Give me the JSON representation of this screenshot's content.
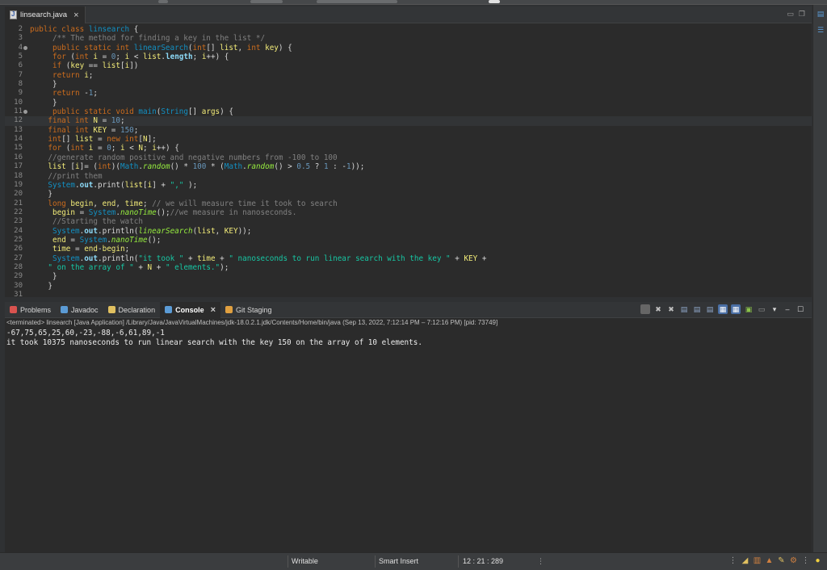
{
  "editor": {
    "tab_label": "linsearch.java",
    "lines": [
      {
        "n": "2",
        "fold": false,
        "current": false,
        "segs": [
          [
            "kw",
            "public class "
          ],
          [
            "cl",
            "linsearch"
          ],
          [
            "ty",
            " {"
          ]
        ]
      },
      {
        "n": "3",
        "fold": false,
        "current": false,
        "segs": [
          [
            "cm",
            "     /** The method for finding a key in the list */"
          ]
        ]
      },
      {
        "n": "4",
        "fold": true,
        "current": false,
        "segs": [
          [
            "ty",
            "     "
          ],
          [
            "kw",
            "public static int "
          ],
          [
            "cl",
            "linearSearch"
          ],
          [
            "ty",
            "("
          ],
          [
            "kw",
            "int"
          ],
          [
            "ty",
            "[] "
          ],
          [
            "lv",
            "list"
          ],
          [
            "ty",
            ", "
          ],
          [
            "kw",
            "int "
          ],
          [
            "lv",
            "key"
          ],
          [
            "ty",
            ") {"
          ]
        ]
      },
      {
        "n": "5",
        "fold": false,
        "current": false,
        "segs": [
          [
            "ty",
            "     "
          ],
          [
            "kw",
            "for "
          ],
          [
            "ty",
            "("
          ],
          [
            "kw",
            "int "
          ],
          [
            "lv",
            "i"
          ],
          [
            "ty",
            " = "
          ],
          [
            "nu",
            "0"
          ],
          [
            "ty",
            "; "
          ],
          [
            "lv",
            "i"
          ],
          [
            "ty",
            " < "
          ],
          [
            "lv",
            "list"
          ],
          [
            "ty",
            "."
          ],
          [
            "fi",
            "length"
          ],
          [
            "ty",
            "; "
          ],
          [
            "lv",
            "i"
          ],
          [
            "ty",
            "++) {"
          ]
        ]
      },
      {
        "n": "6",
        "fold": false,
        "current": false,
        "segs": [
          [
            "ty",
            "     "
          ],
          [
            "kw",
            "if "
          ],
          [
            "ty",
            "("
          ],
          [
            "lv",
            "key"
          ],
          [
            "ty",
            " == "
          ],
          [
            "lv",
            "list"
          ],
          [
            "ty",
            "["
          ],
          [
            "lv",
            "i"
          ],
          [
            "ty",
            "])"
          ]
        ]
      },
      {
        "n": "7",
        "fold": false,
        "current": false,
        "segs": [
          [
            "ty",
            "     "
          ],
          [
            "kw",
            "return "
          ],
          [
            "lv",
            "i"
          ],
          [
            "ty",
            ";"
          ]
        ]
      },
      {
        "n": "8",
        "fold": false,
        "current": false,
        "segs": [
          [
            "ty",
            "     }"
          ]
        ]
      },
      {
        "n": "9",
        "fold": false,
        "current": false,
        "segs": [
          [
            "ty",
            "     "
          ],
          [
            "kw",
            "return "
          ],
          [
            "ty",
            "-"
          ],
          [
            "nu",
            "1"
          ],
          [
            "ty",
            ";"
          ]
        ]
      },
      {
        "n": "10",
        "fold": false,
        "current": false,
        "segs": [
          [
            "ty",
            "     }"
          ]
        ]
      },
      {
        "n": "11",
        "fold": true,
        "current": false,
        "segs": [
          [
            "ty",
            "     "
          ],
          [
            "kw",
            "public static void "
          ],
          [
            "cl",
            "main"
          ],
          [
            "ty",
            "("
          ],
          [
            "cl",
            "String"
          ],
          [
            "ty",
            "[] "
          ],
          [
            "lv",
            "args"
          ],
          [
            "ty",
            ") {"
          ]
        ]
      },
      {
        "n": "12",
        "fold": false,
        "current": true,
        "segs": [
          [
            "ty",
            "    "
          ],
          [
            "kw",
            "final int "
          ],
          [
            "lv",
            "N"
          ],
          [
            "ty",
            " = "
          ],
          [
            "nu",
            "10"
          ],
          [
            "ty",
            ";"
          ]
        ]
      },
      {
        "n": "13",
        "fold": false,
        "current": false,
        "segs": [
          [
            "ty",
            "    "
          ],
          [
            "kw",
            "final int "
          ],
          [
            "lv",
            "KEY"
          ],
          [
            "ty",
            " = "
          ],
          [
            "nu",
            "150"
          ],
          [
            "ty",
            ";"
          ]
        ]
      },
      {
        "n": "14",
        "fold": false,
        "current": false,
        "segs": [
          [
            "ty",
            "    "
          ],
          [
            "kw",
            "int"
          ],
          [
            "ty",
            "[] "
          ],
          [
            "lv",
            "list"
          ],
          [
            "ty",
            " = "
          ],
          [
            "kw",
            "new int"
          ],
          [
            "ty",
            "["
          ],
          [
            "lv",
            "N"
          ],
          [
            "ty",
            "];"
          ]
        ]
      },
      {
        "n": "15",
        "fold": false,
        "current": false,
        "segs": [
          [
            "ty",
            "    "
          ],
          [
            "kw",
            "for "
          ],
          [
            "ty",
            "("
          ],
          [
            "kw",
            "int "
          ],
          [
            "lv",
            "i"
          ],
          [
            "ty",
            " = "
          ],
          [
            "nu",
            "0"
          ],
          [
            "ty",
            "; "
          ],
          [
            "lv",
            "i"
          ],
          [
            "ty",
            " < "
          ],
          [
            "lv",
            "N"
          ],
          [
            "ty",
            "; "
          ],
          [
            "lv",
            "i"
          ],
          [
            "ty",
            "++) {"
          ]
        ]
      },
      {
        "n": "16",
        "fold": false,
        "current": false,
        "segs": [
          [
            "cm",
            "    //generate random positive and negative numbers from -100 to 100"
          ]
        ]
      },
      {
        "n": "17",
        "fold": false,
        "current": false,
        "segs": [
          [
            "ty",
            "    "
          ],
          [
            "lv",
            "list"
          ],
          [
            "ty",
            " ["
          ],
          [
            "lv",
            "i"
          ],
          [
            "ty",
            "]= ("
          ],
          [
            "kw",
            "int"
          ],
          [
            "ty",
            ")("
          ],
          [
            "cl",
            "Math"
          ],
          [
            "ty",
            "."
          ],
          [
            "it",
            "random"
          ],
          [
            "ty",
            "() * "
          ],
          [
            "nu",
            "100"
          ],
          [
            "ty",
            " * ("
          ],
          [
            "cl",
            "Math"
          ],
          [
            "ty",
            "."
          ],
          [
            "it",
            "random"
          ],
          [
            "ty",
            "() > "
          ],
          [
            "nu",
            "0.5"
          ],
          [
            "ty",
            " ? "
          ],
          [
            "nu",
            "1"
          ],
          [
            "ty",
            " : -"
          ],
          [
            "nu",
            "1"
          ],
          [
            "ty",
            "));"
          ]
        ]
      },
      {
        "n": "18",
        "fold": false,
        "current": false,
        "segs": [
          [
            "cm",
            "    //print them"
          ]
        ]
      },
      {
        "n": "19",
        "fold": false,
        "current": false,
        "segs": [
          [
            "ty",
            "    "
          ],
          [
            "cl",
            "System"
          ],
          [
            "ty",
            "."
          ],
          [
            "fi",
            "out"
          ],
          [
            "ty",
            "."
          ],
          [
            "ty",
            "print("
          ],
          [
            "lv",
            "list"
          ],
          [
            "ty",
            "["
          ],
          [
            "lv",
            "i"
          ],
          [
            "ty",
            "] + "
          ],
          [
            "st",
            "\",\""
          ],
          [
            "ty",
            " );"
          ]
        ]
      },
      {
        "n": "20",
        "fold": false,
        "current": false,
        "segs": [
          [
            "ty",
            "    }"
          ]
        ]
      },
      {
        "n": "21",
        "fold": false,
        "current": false,
        "segs": [
          [
            "ty",
            "    "
          ],
          [
            "kw",
            "long "
          ],
          [
            "lv",
            "begin"
          ],
          [
            "ty",
            ", "
          ],
          [
            "lv",
            "end"
          ],
          [
            "ty",
            ", "
          ],
          [
            "lv",
            "time"
          ],
          [
            "ty",
            "; "
          ],
          [
            "cm",
            "// we will measure time it took to search"
          ]
        ]
      },
      {
        "n": "22",
        "fold": false,
        "current": false,
        "segs": [
          [
            "ty",
            "     "
          ],
          [
            "lv",
            "begin"
          ],
          [
            "ty",
            " = "
          ],
          [
            "cl",
            "System"
          ],
          [
            "ty",
            "."
          ],
          [
            "it",
            "nanoTime"
          ],
          [
            "ty",
            "();"
          ],
          [
            "cm",
            "//we measure in nanoseconds."
          ]
        ]
      },
      {
        "n": "23",
        "fold": false,
        "current": false,
        "segs": [
          [
            "cm",
            "     //Starting the watch"
          ]
        ]
      },
      {
        "n": "24",
        "fold": false,
        "current": false,
        "segs": [
          [
            "ty",
            "     "
          ],
          [
            "cl",
            "System"
          ],
          [
            "ty",
            "."
          ],
          [
            "fi",
            "out"
          ],
          [
            "ty",
            "."
          ],
          [
            "ty",
            "println("
          ],
          [
            "it",
            "linearSearch"
          ],
          [
            "ty",
            "("
          ],
          [
            "lv",
            "list"
          ],
          [
            "ty",
            ", "
          ],
          [
            "lv",
            "KEY"
          ],
          [
            "ty",
            "));"
          ]
        ]
      },
      {
        "n": "25",
        "fold": false,
        "current": false,
        "segs": [
          [
            "ty",
            "     "
          ],
          [
            "lv",
            "end"
          ],
          [
            "ty",
            " = "
          ],
          [
            "cl",
            "System"
          ],
          [
            "ty",
            "."
          ],
          [
            "it",
            "nanoTime"
          ],
          [
            "ty",
            "();"
          ]
        ]
      },
      {
        "n": "26",
        "fold": false,
        "current": false,
        "segs": [
          [
            "ty",
            "     "
          ],
          [
            "lv",
            "time"
          ],
          [
            "ty",
            " = "
          ],
          [
            "lv",
            "end"
          ],
          [
            "ty",
            "-"
          ],
          [
            "lv",
            "begin"
          ],
          [
            "ty",
            ";"
          ]
        ]
      },
      {
        "n": "27",
        "fold": false,
        "current": false,
        "segs": [
          [
            "ty",
            "     "
          ],
          [
            "cl",
            "System"
          ],
          [
            "ty",
            "."
          ],
          [
            "fi",
            "out"
          ],
          [
            "ty",
            "."
          ],
          [
            "ty",
            "println("
          ],
          [
            "st",
            "\"it took \""
          ],
          [
            "ty",
            " + "
          ],
          [
            "lv",
            "time"
          ],
          [
            "ty",
            " + "
          ],
          [
            "st",
            "\" nanoseconds to run linear search with the key \""
          ],
          [
            "ty",
            " + "
          ],
          [
            "lv",
            "KEY"
          ],
          [
            "ty",
            " +"
          ]
        ]
      },
      {
        "n": "28",
        "fold": false,
        "current": false,
        "segs": [
          [
            "ty",
            "    "
          ],
          [
            "st",
            "\" on the array of \""
          ],
          [
            "ty",
            " + "
          ],
          [
            "lv",
            "N"
          ],
          [
            "ty",
            " + "
          ],
          [
            "st",
            "\" elements.\""
          ],
          [
            "ty",
            ");"
          ]
        ]
      },
      {
        "n": "29",
        "fold": false,
        "current": false,
        "segs": [
          [
            "ty",
            "     }"
          ]
        ]
      },
      {
        "n": "30",
        "fold": false,
        "current": false,
        "segs": [
          [
            "ty",
            "    }"
          ]
        ]
      },
      {
        "n": "31",
        "fold": false,
        "current": false,
        "segs": [
          [
            "ty",
            ""
          ]
        ]
      }
    ]
  },
  "panel": {
    "tabs": [
      {
        "label": "Problems",
        "icon": "problems-icon",
        "color": "#d9534f",
        "active": false
      },
      {
        "label": "Javadoc",
        "icon": "javadoc-icon",
        "color": "#5b9bd5",
        "active": false
      },
      {
        "label": "Declaration",
        "icon": "declaration-icon",
        "color": "#e0c060",
        "active": false
      },
      {
        "label": "Console",
        "icon": "console-icon",
        "color": "#5b9bd5",
        "active": true
      },
      {
        "label": "Git Staging",
        "icon": "git-staging-icon",
        "color": "#e0a040",
        "active": false
      }
    ]
  },
  "console": {
    "header": "<terminated> linsearch [Java Application] /Library/Java/JavaVirtualMachines/jdk-18.0.2.1.jdk/Contents/Home/bin/java  (Sep 13, 2022, 7:12:14 PM – 7:12:16 PM) [pid: 73749]",
    "output": [
      "-67,75,65,25,60,-23,-88,-6,61,89,-1",
      "it took 10375 nanoseconds to run linear search with the key 150 on the array of 10 elements."
    ]
  },
  "status": {
    "writable": "Writable",
    "insert_mode": "Smart Insert",
    "position": "12 : 21 : 289"
  },
  "colors": {
    "accent": "#5b9bd5",
    "keyword": "#cc6c1d",
    "string": "#17c6a3"
  }
}
